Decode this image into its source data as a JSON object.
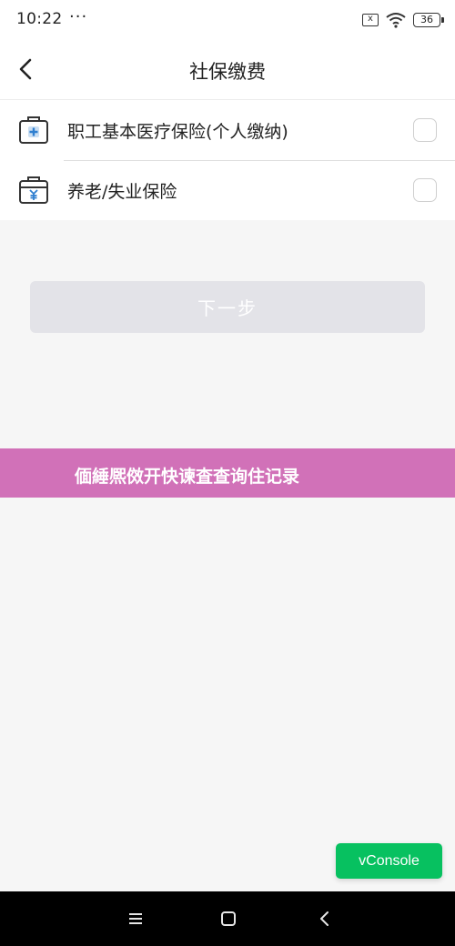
{
  "status_bar": {
    "time": "10:22",
    "dots": "···",
    "sim_icon": "x",
    "wifi_icon": "wifi-icon",
    "battery_level": "36"
  },
  "nav": {
    "title": "社保缴费",
    "back_icon": "chevron-left-icon"
  },
  "insurance_items": [
    {
      "label": "职工基本医疗保险(个人缴纳)",
      "icon": "medical-kit-icon",
      "checked": false
    },
    {
      "label": "养老/失业保险",
      "icon": "pension-case-icon",
      "checked": false
    }
  ],
  "next_button": {
    "label": "下一步"
  },
  "overlay_banner": {
    "text": "偭綞熈傚开快谏査查询住记录"
  },
  "vconsole": {
    "label": "vConsole"
  },
  "colors": {
    "accent_blue": "#2f7fd0",
    "vconsole_green": "#07c160",
    "banner_pink": "#d171b8",
    "disabled_button": "#e3e3e8"
  }
}
